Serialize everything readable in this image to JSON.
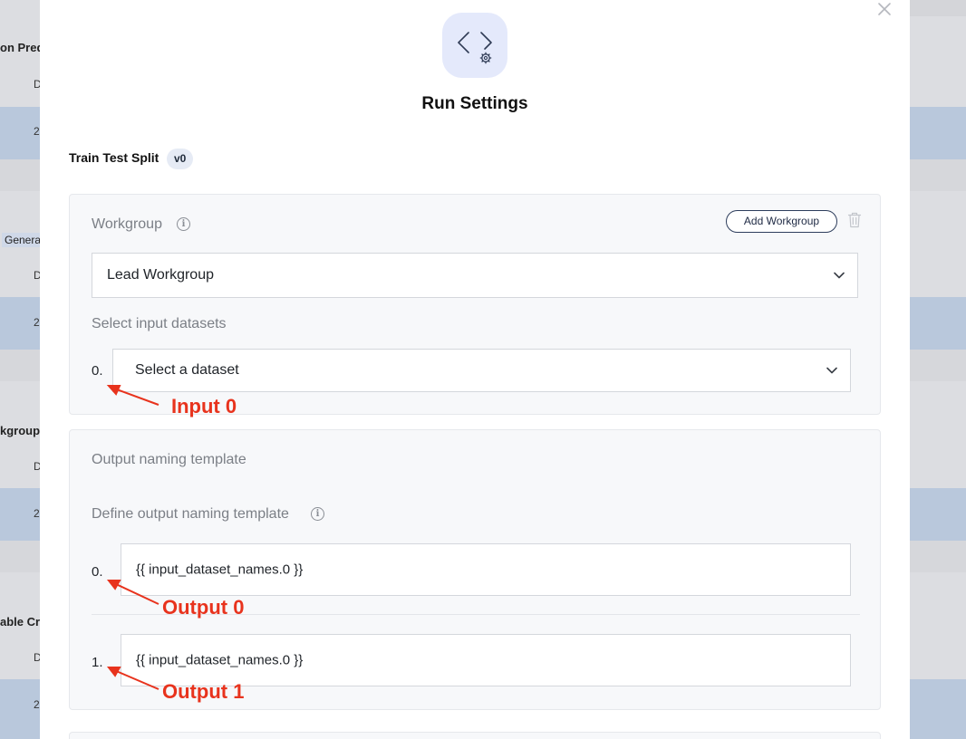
{
  "background": {
    "left_texts": [
      "on Pred",
      "Genera",
      "kgroup",
      "able Cr"
    ],
    "left_small": [
      "D",
      "2",
      "D",
      "2",
      "D",
      "2",
      "D",
      "2"
    ]
  },
  "modal": {
    "title": "Run Settings",
    "close_icon": "close-icon",
    "header_icon": "code-settings-icon",
    "task_name": "Train Test Split",
    "version": "v0"
  },
  "workgroup_panel": {
    "label": "Workgroup",
    "add_button": "Add Workgroup",
    "selected_workgroup": "Lead Workgroup",
    "input_datasets_label": "Select input datasets",
    "inputs": [
      {
        "index": "0.",
        "placeholder": "Select a dataset"
      }
    ]
  },
  "output_panel": {
    "title": "Output naming template",
    "define_label": "Define output naming template",
    "outputs": [
      {
        "index": "0.",
        "value": "{{ input_dataset_names.0 }}"
      },
      {
        "index": "1.",
        "value": "{{ input_dataset_names.0 }}"
      }
    ]
  },
  "annotations": {
    "input0": "Input 0",
    "output0": "Output 0",
    "output1": "Output 1",
    "color": "#e8331d"
  },
  "colors": {
    "panel_bg": "#f7f8fa",
    "icon_bg": "#e4e9fb",
    "accent": "#2d3d5c"
  }
}
